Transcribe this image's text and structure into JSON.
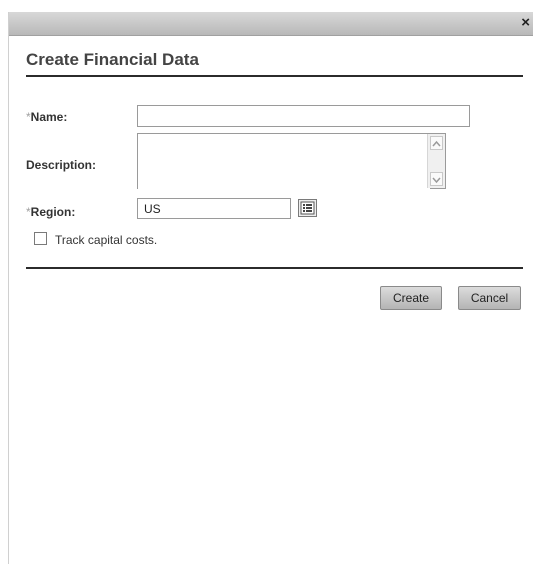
{
  "window": {
    "close_symbol": "×"
  },
  "dialog": {
    "title": "Create Financial Data"
  },
  "form": {
    "name": {
      "required_mark": "*",
      "label": "Name:",
      "value": ""
    },
    "description": {
      "label": "Description:",
      "value": ""
    },
    "region": {
      "required_mark": "*",
      "label": "Region:",
      "value": "US",
      "picker_icon": "list-picker-icon"
    },
    "track_capital_costs": {
      "label": "Track capital costs.",
      "checked": false
    }
  },
  "buttons": {
    "create": "Create",
    "cancel": "Cancel"
  }
}
